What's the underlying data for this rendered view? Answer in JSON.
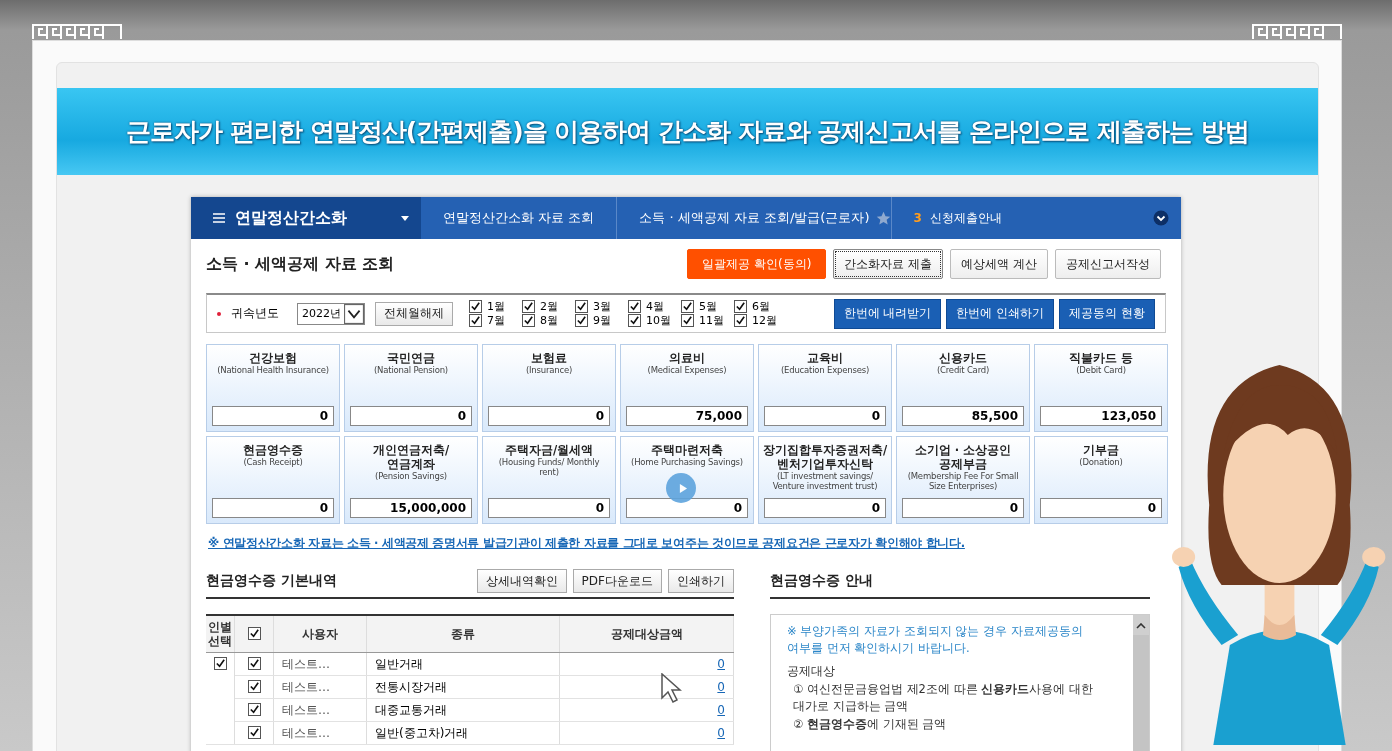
{
  "banner": {
    "title": "근로자가 편리한 연말정산(간편제출)을 이용하여 간소화 자료와 공제신고서를 온라인으로 제출하는 방법"
  },
  "nav": {
    "menu_title": "연말정산간소화",
    "breadcrumbs": [
      "연말정산간소화 자료 조회",
      "소득 · 세액공제 자료 조회/발급(근로자)"
    ],
    "step_number": "3",
    "step_label": "신청제출안내"
  },
  "page": {
    "title": "소득 · 세액공제 자료 조회",
    "actions": [
      {
        "label": "일괄제공 확인(동의)",
        "kind": "primary"
      },
      {
        "label": "간소화자료 제출",
        "kind": "focused"
      },
      {
        "label": "예상세액 계산",
        "kind": "default"
      },
      {
        "label": "공제신고서작성",
        "kind": "default"
      }
    ]
  },
  "filter": {
    "label": "귀속년도",
    "year": "2022년",
    "clear_button": "전체월해제",
    "months": [
      {
        "label": "1월",
        "checked": true
      },
      {
        "label": "2월",
        "checked": true
      },
      {
        "label": "3월",
        "checked": true
      },
      {
        "label": "4월",
        "checked": true
      },
      {
        "label": "5월",
        "checked": true
      },
      {
        "label": "6월",
        "checked": true
      },
      {
        "label": "7월",
        "checked": true
      },
      {
        "label": "8월",
        "checked": true
      },
      {
        "label": "9월",
        "checked": true
      },
      {
        "label": "10월",
        "checked": true
      },
      {
        "label": "11월",
        "checked": true
      },
      {
        "label": "12월",
        "checked": true
      }
    ],
    "buttons": [
      "한번에 내려받기",
      "한번에 인쇄하기",
      "제공동의 현황"
    ]
  },
  "cards": [
    {
      "title": "건강보험",
      "subtitle": "(National Health Insurance)",
      "value": "0"
    },
    {
      "title": "국민연금",
      "subtitle": "(National Pension)",
      "value": "0"
    },
    {
      "title": "보험료",
      "subtitle": "(Insurance)",
      "value": "0"
    },
    {
      "title": "의료비",
      "subtitle": "(Medical Expenses)",
      "value": "75,000"
    },
    {
      "title": "교육비",
      "subtitle": "(Education Expenses)",
      "value": "0"
    },
    {
      "title": "신용카드",
      "subtitle": "(Credit Card)",
      "value": "85,500"
    },
    {
      "title": "직불카드 등",
      "subtitle": "(Debit Card)",
      "value": "123,050"
    },
    {
      "title": "현금영수증",
      "subtitle": "(Cash Receipt)",
      "value": "0"
    },
    {
      "title": "개인연금저축/ 연금계좌",
      "subtitle": "(Pension Savings)",
      "value": "15,000,000"
    },
    {
      "title": "주택자금/월세액",
      "subtitle": "(Housing Funds/ Monthly rent)",
      "value": "0"
    },
    {
      "title": "주택마련저축",
      "subtitle": "(Home Purchasing Savings)",
      "value": "0"
    },
    {
      "title": "장기집합투자증권저축/ 벤처기업투자신탁",
      "subtitle": "(LT investment savings/ Venture investment trust)",
      "value": "0"
    },
    {
      "title": "소기업 · 소상공인 공제부금",
      "subtitle": "(Membership Fee For Small Size Enterprises)",
      "value": "0"
    },
    {
      "title": "기부금",
      "subtitle": "(Donation)",
      "value": "0"
    }
  ],
  "notice": "※ 연말정산간소화 자료는 소득 · 세액공제 증명서류 발급기관이 제출한 자료를 그대로 보여주는 것이므로 공제요건은 근로자가 확인해야 합니다.",
  "receipts": {
    "title": "현금영수증 기본내역",
    "buttons": [
      "상세내역확인",
      "PDF다운로드",
      "인쇄하기"
    ],
    "columns": [
      "인별 선택",
      "사용자",
      "종류",
      "공제대상금액"
    ],
    "all_checked": true,
    "person_checked": true,
    "rows": [
      {
        "user": "테스트…",
        "type": "일반거래",
        "amount": "0",
        "checked": true
      },
      {
        "user": "테스트…",
        "type": "전통시장거래",
        "amount": "0",
        "checked": true
      },
      {
        "user": "테스트…",
        "type": "대중교통거래",
        "amount": "0",
        "checked": true
      },
      {
        "user": "테스트…",
        "type": "일반(중고차)거래",
        "amount": "0",
        "checked": true
      }
    ]
  },
  "guide": {
    "title": "현금영수증 안내",
    "note": "※ 부양가족의 자료가 조회되지 않는 경우 자료제공동의 여부를 먼저 확인하시기 바랍니다.",
    "items": [
      {
        "kind": "bullet",
        "text": "공제대상"
      },
      {
        "kind": "line",
        "text": "① 여신전문금융업법 제2조에 따른 **신용카드**사용에 대한 대가로 지급하는 금액"
      },
      {
        "kind": "line",
        "text": "② **현금영수증**에 기재된 금액"
      }
    ]
  }
}
